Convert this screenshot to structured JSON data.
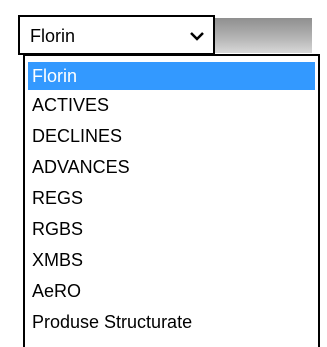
{
  "select": {
    "value": "Florin",
    "arrow_icon": "chevron-down-icon"
  },
  "dropdown": {
    "options": [
      "Florin",
      "ACTIVES",
      "DECLINES",
      "ADVANCES",
      "REGS",
      "RGBS",
      "XMBS",
      "AeRO",
      "Produse Structurate"
    ],
    "selected_index": 0
  },
  "colors": {
    "highlight": "#3399ff",
    "border": "#000000"
  }
}
